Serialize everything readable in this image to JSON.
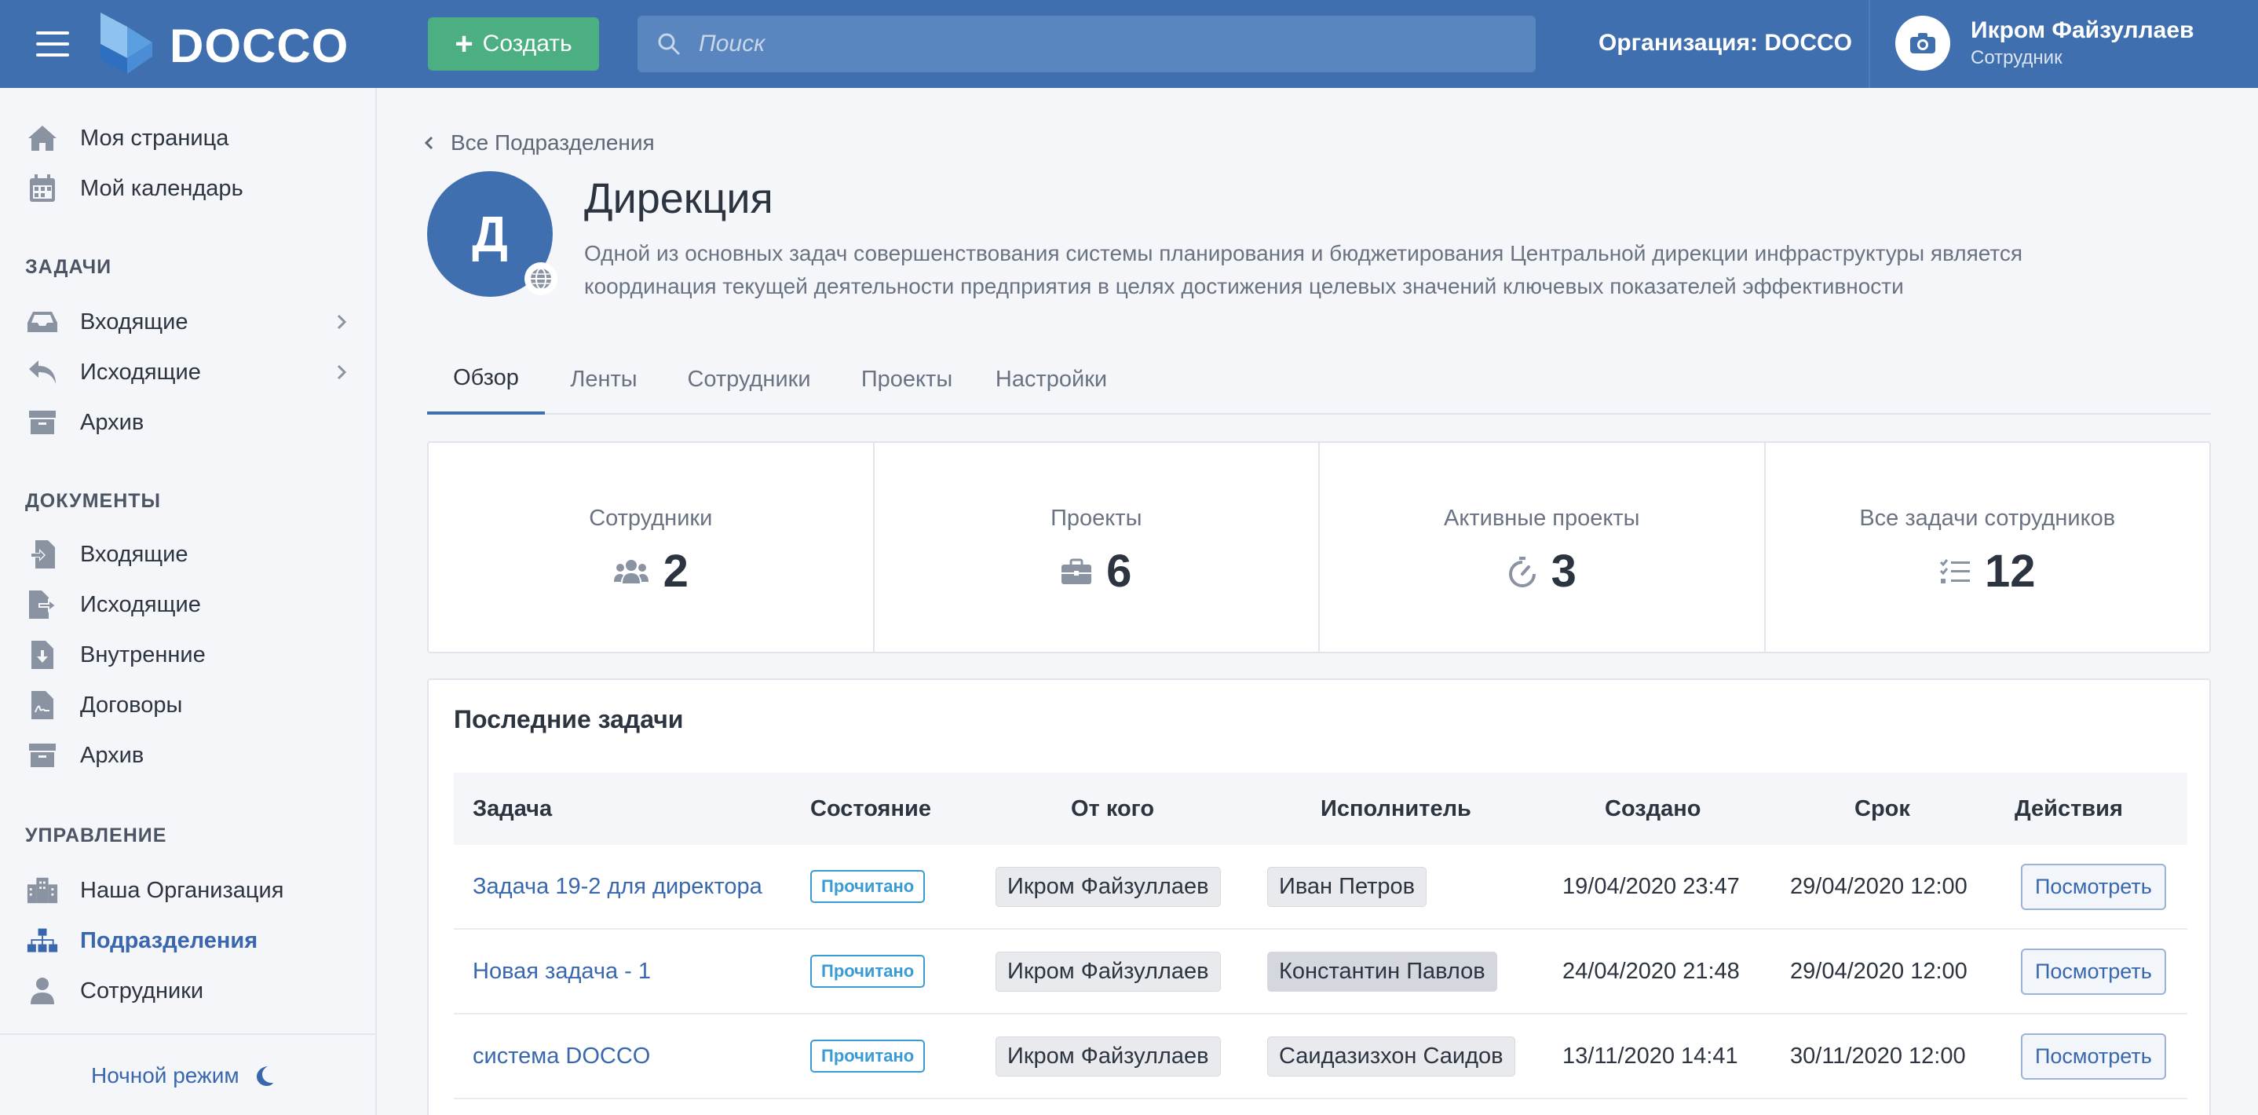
{
  "header": {
    "logo_text": "DOCCO",
    "create_label": "Создать",
    "search_placeholder": "Поиск",
    "org_label": "Организация: DOCCO",
    "user_name": "Икром Файзуллаев",
    "user_role": "Сотрудник"
  },
  "sidebar": {
    "top_items": [
      {
        "label": "Моя страница",
        "icon": "home-icon"
      },
      {
        "label": "Мой календарь",
        "icon": "calendar-icon"
      }
    ],
    "tasks_title": "ЗАДАЧИ",
    "tasks_items": [
      {
        "label": "Входящие",
        "icon": "inbox-icon"
      },
      {
        "label": "Исходящие",
        "icon": "reply-icon"
      },
      {
        "label": "Архив",
        "icon": "archive-icon"
      }
    ],
    "docs_title": "ДОКУМЕНТЫ",
    "docs_items": [
      {
        "label": "Входящие",
        "icon": "file-import-icon"
      },
      {
        "label": "Исходящие",
        "icon": "file-export-icon"
      },
      {
        "label": "Внутренние",
        "icon": "file-download-icon"
      },
      {
        "label": "Договоры",
        "icon": "file-contract-icon"
      },
      {
        "label": "Архив",
        "icon": "archive-icon"
      }
    ],
    "manage_title": "УПРАВЛЕНИЕ",
    "manage_items": [
      {
        "label": "Наша Организация",
        "icon": "building-icon"
      },
      {
        "label": "Подразделения",
        "icon": "sitemap-icon"
      },
      {
        "label": "Сотрудники",
        "icon": "user-icon"
      }
    ],
    "night_mode_label": "Ночной режим"
  },
  "breadcrumb": "Все Подразделения",
  "department": {
    "avatar_letter": "Д",
    "title": "Дирекция",
    "description": "Одной из основных задач совершенствования системы планирования и бюджетирования Центральной дирекции инфраструктуры является координация текущей деятельности предприятия в целях достижения целевых значений ключевых показателей эффективности"
  },
  "tabs": [
    "Обзор",
    "Ленты",
    "Сотрудники",
    "Проекты",
    "Настройки"
  ],
  "stats": [
    {
      "label": "Сотрудники",
      "value": "2",
      "icon": "users-icon"
    },
    {
      "label": "Проекты",
      "value": "6",
      "icon": "briefcase-icon"
    },
    {
      "label": "Активные проекты",
      "value": "3",
      "icon": "stopwatch-icon"
    },
    {
      "label": "Все задачи сотрудников",
      "value": "12",
      "icon": "tasks-list-icon"
    }
  ],
  "tasks": {
    "title": "Последние задачи",
    "columns": [
      "Задача",
      "Состояние",
      "От кого",
      "Исполнитель",
      "Создано",
      "Срок",
      "Действия"
    ],
    "rows": [
      {
        "task": "Задача 19-2 для директора",
        "status": "Прочитано",
        "from": "Икром Файзуллаев",
        "assignee": "Иван Петров",
        "created": "19/04/2020 23:47",
        "deadline": "29/04/2020 12:00",
        "action": "Посмотреть"
      },
      {
        "task": "Новая задача - 1",
        "status": "Прочитано",
        "from": "Икром Файзуллаев",
        "assignee": "Константин Павлов",
        "created": "24/04/2020 21:48",
        "deadline": "29/04/2020 12:00",
        "action": "Посмотреть"
      },
      {
        "task": "система DOCCO",
        "status": "Прочитано",
        "from": "Икром Файзуллаев",
        "assignee": "Саидазизхон Саидов",
        "created": "13/11/2020 14:41",
        "deadline": "30/11/2020 12:00",
        "action": "Посмотреть"
      }
    ]
  },
  "colors": {
    "header_bg": "#3f6fae",
    "create_btn": "#4caf82",
    "link": "#3867ad",
    "status_badge": "#3a9bd5"
  }
}
